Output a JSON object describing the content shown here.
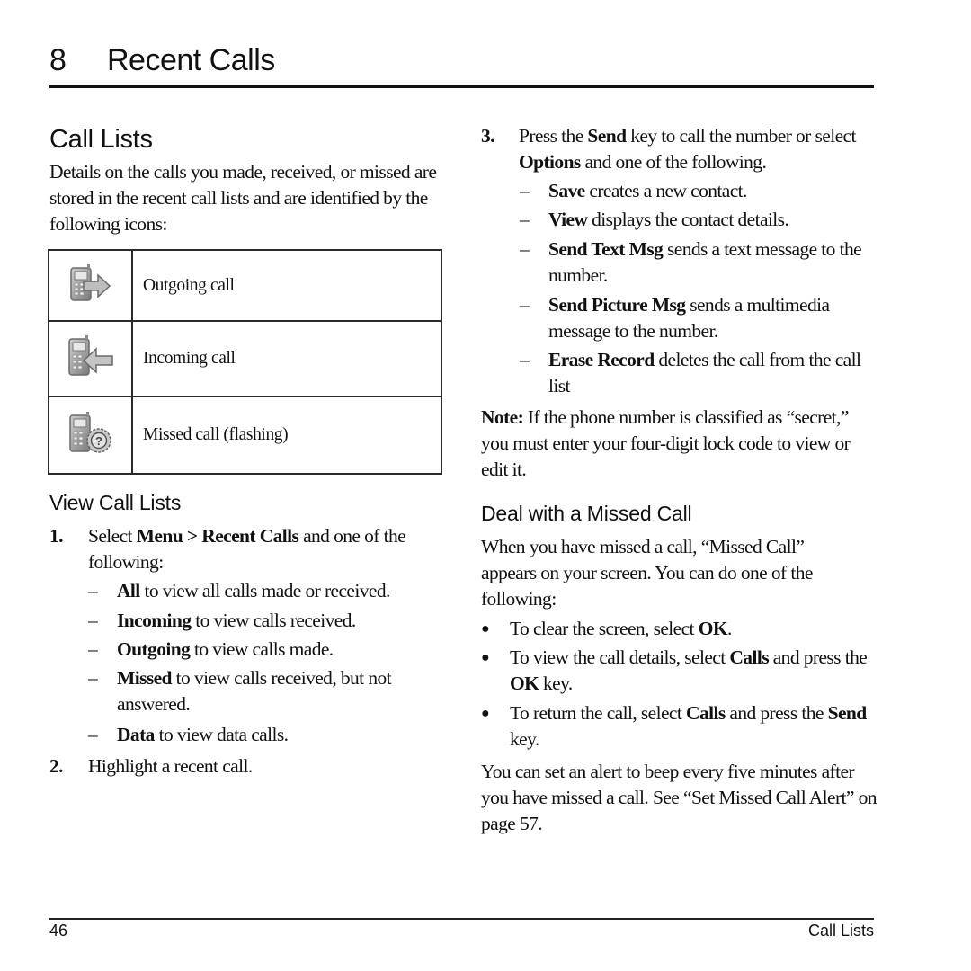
{
  "chapter": {
    "number": "8",
    "title": "Recent Calls"
  },
  "call_lists": {
    "heading": "Call Lists",
    "intro": "Details on the calls you made, received, or missed are stored in the recent call lists and are identified by the following icons:",
    "icons": [
      {
        "icon": "outgoing-call-icon",
        "label": "Outgoing call"
      },
      {
        "icon": "incoming-call-icon",
        "label": "Incoming call"
      },
      {
        "icon": "missed-call-icon",
        "label": "Missed call (flashing)"
      }
    ]
  },
  "view_call_lists": {
    "heading": "View Call Lists",
    "step1": {
      "num": "1.",
      "pre": "Select ",
      "bold": "Menu > Recent Calls",
      "post": " and one of the following:"
    },
    "options": [
      {
        "bold": "All",
        "text": " to view all calls made or received."
      },
      {
        "bold": "Incoming",
        "text": " to view calls received."
      },
      {
        "bold": "Outgoing",
        "text": " to view calls made."
      },
      {
        "bold": "Missed",
        "text": " to view calls received, but not answered."
      },
      {
        "bold": "Data",
        "text": " to view data calls."
      }
    ],
    "step2": {
      "num": "2.",
      "text": "Highlight a recent call."
    }
  },
  "step3": {
    "num": "3.",
    "pre": "Press the ",
    "bold1": "Send",
    "mid": " key to call the number or select ",
    "bold2": "Options",
    "post": " and one of the following.",
    "options": [
      {
        "bold": "Save",
        "text": " creates a new contact."
      },
      {
        "bold": "View",
        "text": " displays the contact details."
      },
      {
        "bold": "Send Text Msg",
        "text": " sends a text message to the number."
      },
      {
        "bold": "Send Picture Msg",
        "text": " sends a multimedia message to the number."
      },
      {
        "bold": "Erase Record",
        "text": " deletes the call from the call list"
      }
    ]
  },
  "note": {
    "label": "Note:",
    "text": " If the phone number is classified as “secret,” you must enter your four-digit lock code to view or edit it."
  },
  "missed_call": {
    "heading": "Deal with a Missed Call",
    "intro": "When you have missed a call, “Missed Call” appears on your screen. You can do one of the following:",
    "bullets": [
      {
        "pre": "To clear the screen, select ",
        "bold": "OK",
        "post": "."
      },
      {
        "pre": "To view the call details, select ",
        "bold": "Calls",
        "mid": " and press the ",
        "bold2": "OK",
        "post": " key."
      },
      {
        "pre": "To return the call, select ",
        "bold": "Calls",
        "mid": " and press the ",
        "bold2": "Send",
        "post": " key."
      }
    ],
    "closing": "You can set an alert to beep every five minutes after you have missed a call. See “Set Missed Call Alert” on page 57."
  },
  "footer": {
    "page_number": "46",
    "section": "Call Lists"
  }
}
